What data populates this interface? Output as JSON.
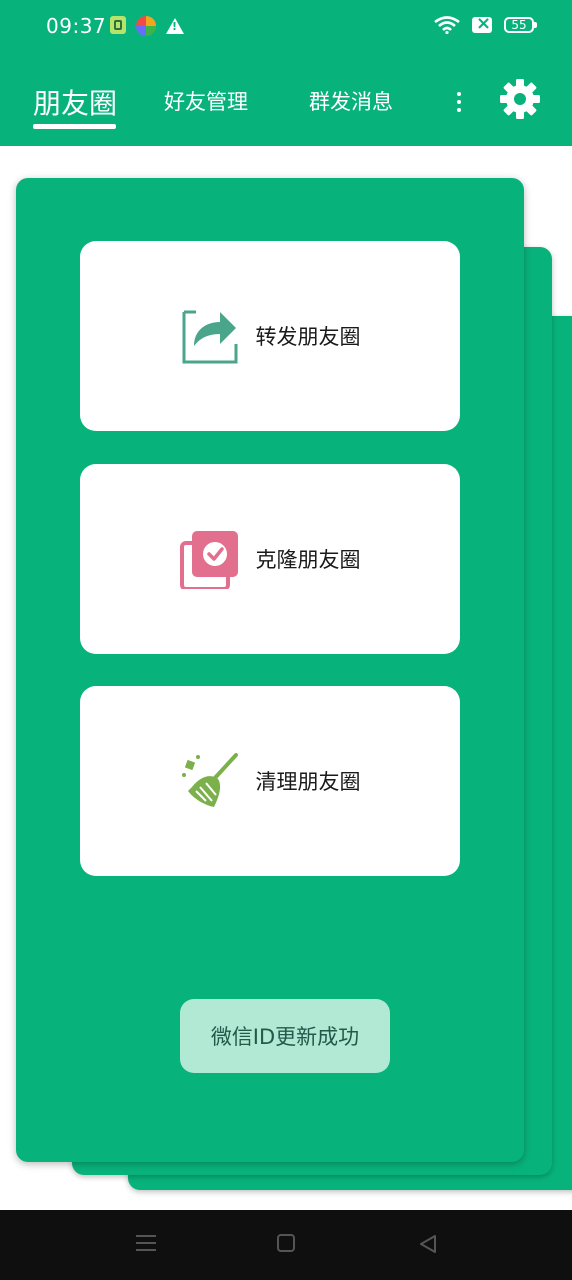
{
  "status_bar": {
    "time": "09:37",
    "battery": "55",
    "icons": [
      "sim-icon",
      "app-icon",
      "alert-icon",
      "wifi-icon",
      "x-icon",
      "battery-icon"
    ]
  },
  "tabs": [
    {
      "label": "朋友圈",
      "active": true
    },
    {
      "label": "好友管理",
      "active": false
    },
    {
      "label": "群发消息",
      "active": false
    }
  ],
  "header_icons": [
    "more-icon",
    "settings-icon"
  ],
  "actions": [
    {
      "label": "转发朋友圈",
      "icon": "share-icon",
      "color": "#4aa58a"
    },
    {
      "label": "克隆朋友圈",
      "icon": "clone-icon",
      "color": "#e26f8e"
    },
    {
      "label": "清理朋友圈",
      "icon": "broom-icon",
      "color": "#7bb04a"
    }
  ],
  "toast": "微信ID更新成功",
  "colors": {
    "primary": "#08b37b",
    "toast_bg": "#b1e9d4",
    "navbar": "#0f0f0f"
  },
  "nav_icons": [
    "menu-icon",
    "home-icon",
    "back-icon"
  ]
}
